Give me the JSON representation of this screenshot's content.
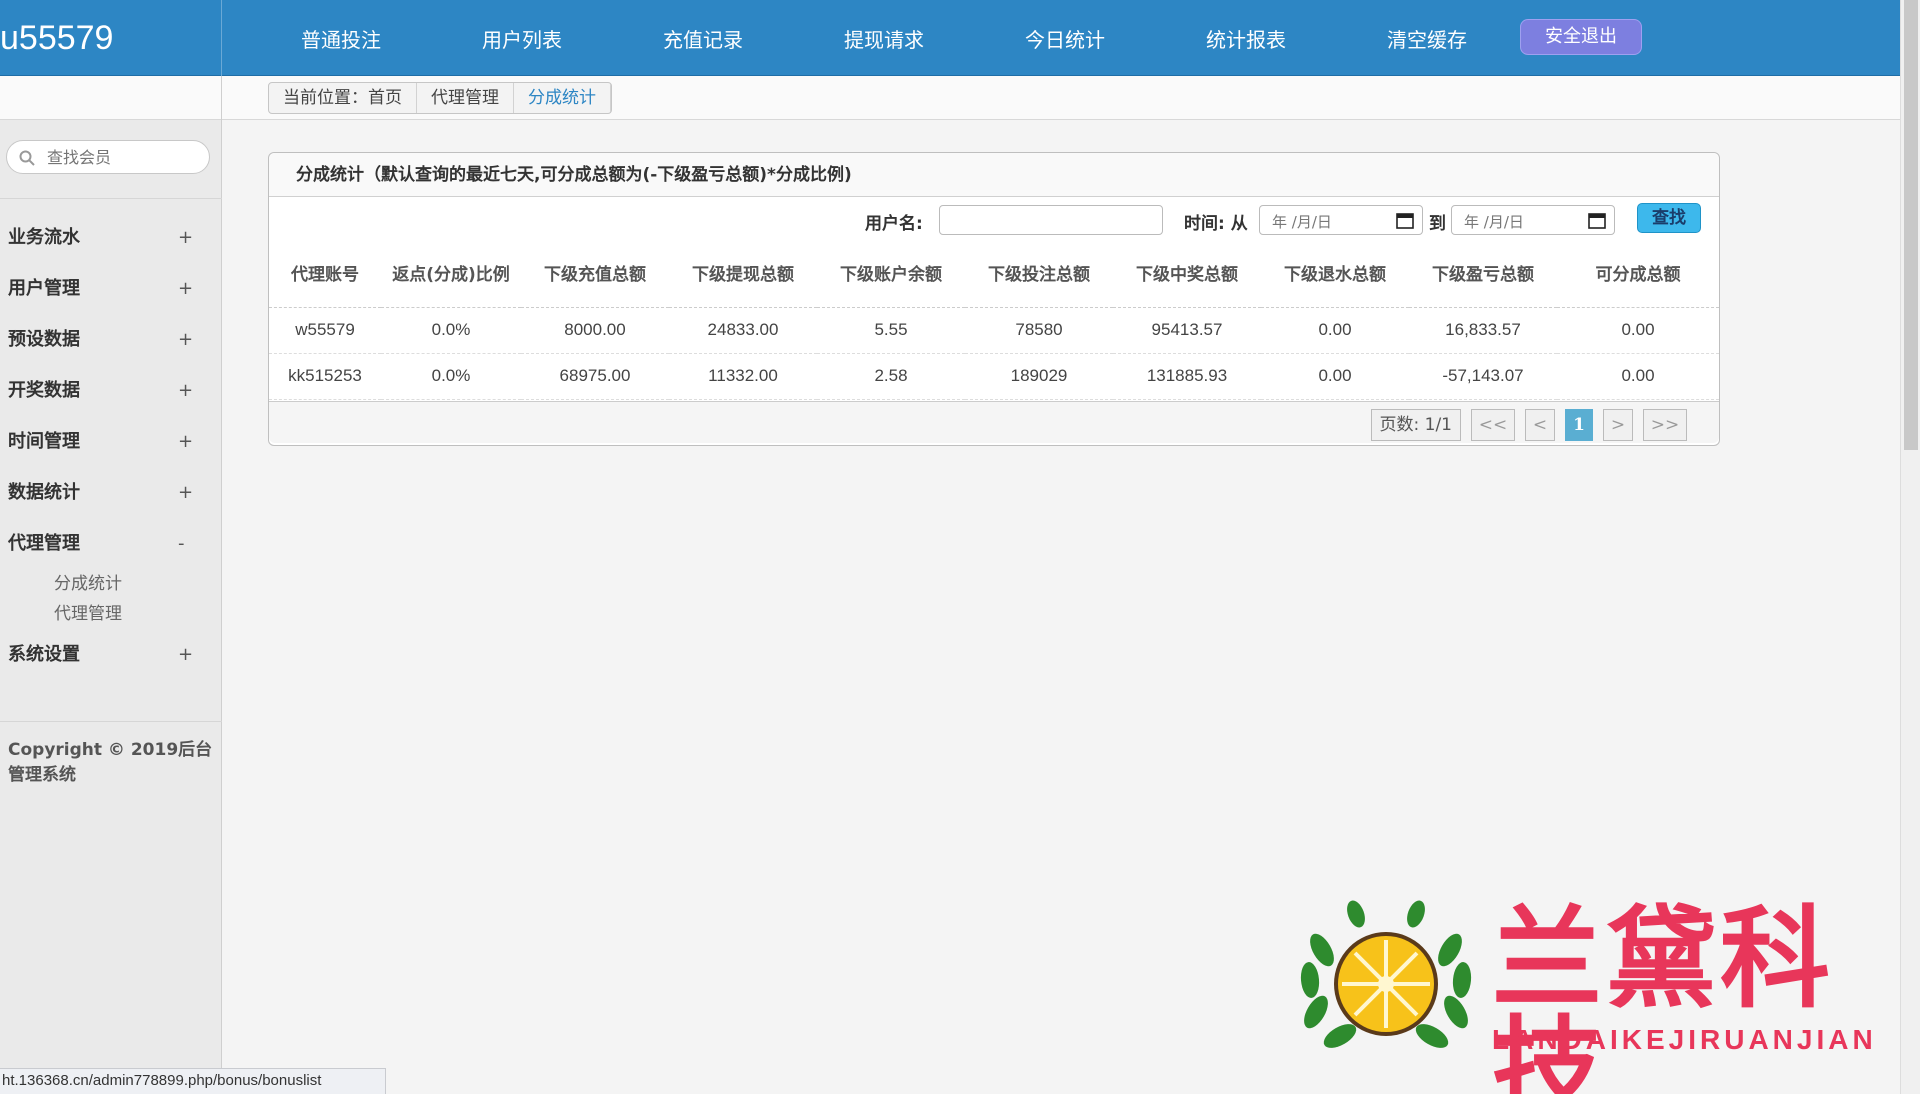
{
  "header": {
    "brand": "u55579",
    "nav": [
      "普通投注",
      "用户列表",
      "充值记录",
      "提现请求",
      "今日统计",
      "统计报表",
      "清空缓存"
    ],
    "logout_label": "安全退出"
  },
  "breadcrumb": [
    "当前位置：首页",
    "代理管理",
    "分成统计"
  ],
  "sidebar": {
    "search_placeholder": "查找会员",
    "menu": [
      {
        "label": "业务流水",
        "toggle": "+"
      },
      {
        "label": "用户管理",
        "toggle": "+"
      },
      {
        "label": "预设数据",
        "toggle": "+"
      },
      {
        "label": "开奖数据",
        "toggle": "+"
      },
      {
        "label": "时间管理",
        "toggle": "+"
      },
      {
        "label": "数据统计",
        "toggle": "+"
      },
      {
        "label": "代理管理",
        "toggle": "-"
      }
    ],
    "submenu": [
      "分成统计",
      "代理管理"
    ],
    "menu_after": {
      "label": "系统设置",
      "toggle": "+"
    },
    "copyright": "Copyright © 2019后台管理系统"
  },
  "panel": {
    "title": "分成统计（默认查询的最近七天,可分成总额为(-下级盈亏总额)*分成比例)",
    "filter": {
      "username_label": "用户名:",
      "username_value": "",
      "time_label": "时间: 从",
      "to_label": "到",
      "date_from_placeholder": "年 /月/日",
      "date_to_placeholder": "年 /月/日",
      "search_button": "查找"
    },
    "table": {
      "headers": [
        "代理账号",
        "返点(分成)比例",
        "下级充值总额",
        "下级提现总额",
        "下级账户余额",
        "下级投注总额",
        "下级中奖总额",
        "下级退水总额",
        "下级盈亏总额",
        "可分成总额"
      ],
      "rows": [
        [
          "w55579",
          "0.0%",
          "8000.00",
          "24833.00",
          "5.55",
          "78580",
          "95413.57",
          "0.00",
          "16,833.57",
          "0.00"
        ],
        [
          "kk515253",
          "0.0%",
          "68975.00",
          "11332.00",
          "2.58",
          "189029",
          "131885.93",
          "0.00",
          "-57,143.07",
          "0.00"
        ]
      ]
    },
    "pager": {
      "info": "页数: 1/1",
      "first": "<<",
      "prev": "<",
      "current": "1",
      "next": ">",
      "last": ">>"
    }
  },
  "statusbar": {
    "url": "ht.136368.cn/admin778899.php/bonus/bonuslist"
  },
  "watermark": {
    "title": "兰黛科技",
    "subtitle": "LANDAIKEJIRUANJIAN"
  },
  "colors": {
    "header": "#2d86c4",
    "accent": "#3db8ec",
    "logout": "#7d7fe0",
    "watermark": "#e8365a"
  }
}
